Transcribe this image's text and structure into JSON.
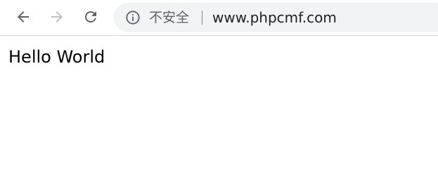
{
  "browser": {
    "security_label": "不安全",
    "url": "www.phpcmf.com",
    "icons": {
      "back": "arrow-left-icon",
      "forward": "arrow-right-icon",
      "reload": "reload-icon",
      "info": "info-icon"
    },
    "colors": {
      "icon_active": "#5f6368",
      "icon_disabled": "#bdc1c6",
      "omnibox_bg": "#f1f3f4"
    }
  },
  "page": {
    "body_text": "Hello World"
  }
}
